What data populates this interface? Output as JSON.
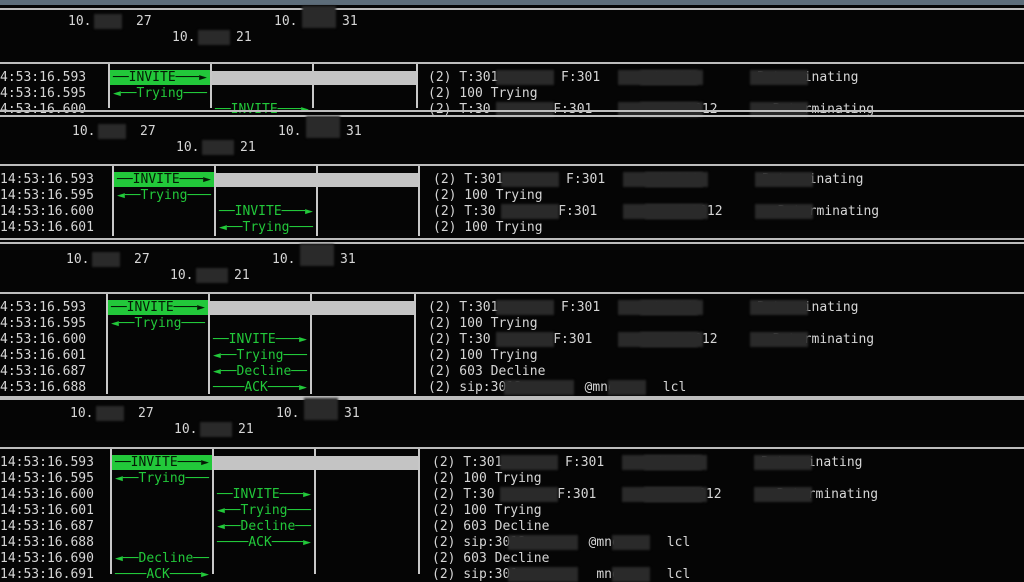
{
  "panels": [
    {
      "ip_left": "10.",
      "ip_left_end": "27",
      "ip_mid": "10.",
      "ip_mid_end": "21",
      "ip_right": "10.",
      "ip_right_end": "31",
      "rows": [
        {
          "time": "4:53:16.593",
          "arrow": "INVITE",
          "dir": "r",
          "lane": 0,
          "sel": true,
          "info": "(2) T:301        F:301       U:301        P:terminating"
        },
        {
          "time": "4:53:16.595",
          "arrow": "Trying",
          "dir": "l",
          "lane": 0,
          "info": "(2) 100 Trying"
        },
        {
          "time": "4:53:16.600",
          "arrow": "INVITE",
          "dir": "r",
          "lane": 1,
          "info": "(2) T:30        F:301          #:3012       P:terminating"
        }
      ]
    },
    {
      "ip_left": "10.",
      "ip_left_end": "27",
      "ip_mid": "10.",
      "ip_mid_end": "21",
      "ip_right": "10.",
      "ip_right_end": "31",
      "rows": [
        {
          "time": "14:53:16.593",
          "arrow": "INVITE",
          "dir": "r",
          "lane": 0,
          "sel": true,
          "info": "(2) T:301        F:301       U:301        P:terminating"
        },
        {
          "time": "14:53:16.595",
          "arrow": "Trying",
          "dir": "l",
          "lane": 0,
          "info": "(2) 100 Trying"
        },
        {
          "time": "14:53:16.600",
          "arrow": "INVITE",
          "dir": "r",
          "lane": 1,
          "info": "(2) T:30        F:301          #:3012       P:terminating"
        },
        {
          "time": "14:53:16.601",
          "arrow": "Trying",
          "dir": "l",
          "lane": 1,
          "info": "(2) 100 Trying"
        }
      ]
    },
    {
      "ip_left": "10.",
      "ip_left_end": "27",
      "ip_mid": "10.",
      "ip_mid_end": "21",
      "ip_right": "10.",
      "ip_right_end": "31",
      "rows": [
        {
          "time": "4:53:16.593",
          "arrow": "INVITE",
          "dir": "r",
          "lane": 0,
          "sel": true,
          "info": "(2) T:301        F:301       U:301        P:terminating"
        },
        {
          "time": "4:53:16.595",
          "arrow": "Trying",
          "dir": "l",
          "lane": 0,
          "info": "(2) 100 Trying"
        },
        {
          "time": "4:53:16.600",
          "arrow": "INVITE",
          "dir": "r",
          "lane": 1,
          "info": "(2) T:30        F:301          #:3012       P:terminating"
        },
        {
          "time": "4:53:16.601",
          "arrow": "Trying",
          "dir": "l",
          "lane": 1,
          "info": "(2) 100 Trying"
        },
        {
          "time": "4:53:16.687",
          "arrow": "Decline",
          "dir": "l",
          "lane": 1,
          "info": "(2) 603 Decline"
        },
        {
          "time": "4:53:16.688",
          "arrow": "ACK",
          "dir": "r",
          "lane": 1,
          "info": "(2) sip:3012        @mno      lcl"
        }
      ]
    },
    {
      "ip_left": "10.",
      "ip_left_end": "27",
      "ip_mid": "10.",
      "ip_mid_end": "21",
      "ip_right": "10.",
      "ip_right_end": "31",
      "rows": [
        {
          "time": "14:53:16.593",
          "arrow": "INVITE",
          "dir": "r",
          "lane": 0,
          "sel": true,
          "info": "(2) T:301        F:301       U:301        P:terminating"
        },
        {
          "time": "14:53:16.595",
          "arrow": "Trying",
          "dir": "l",
          "lane": 0,
          "info": "(2) 100 Trying"
        },
        {
          "time": "14:53:16.600",
          "arrow": "INVITE",
          "dir": "r",
          "lane": 1,
          "info": "(2) T:30        F:301          #:3012       P:terminating"
        },
        {
          "time": "14:53:16.601",
          "arrow": "Trying",
          "dir": "l",
          "lane": 1,
          "info": "(2) 100 Trying"
        },
        {
          "time": "14:53:16.687",
          "arrow": "Decline",
          "dir": "l",
          "lane": 1,
          "info": "(2) 603 Decline"
        },
        {
          "time": "14:53:16.688",
          "arrow": "ACK",
          "dir": "r",
          "lane": 1,
          "info": "(2) sip:3012        @mno      lcl"
        },
        {
          "time": "14:53:16.690",
          "arrow": "Decline",
          "dir": "l",
          "lane": 0,
          "info": "(2) 603 Decline"
        },
        {
          "time": "14:53:16.691",
          "arrow": "ACK",
          "dir": "r",
          "lane": 0,
          "info": "(2) sip:301          mno      lcl"
        }
      ]
    }
  ],
  "colors": {
    "arrow": "#22c83a",
    "bar": "#c4c4c4",
    "bg": "#050505"
  }
}
